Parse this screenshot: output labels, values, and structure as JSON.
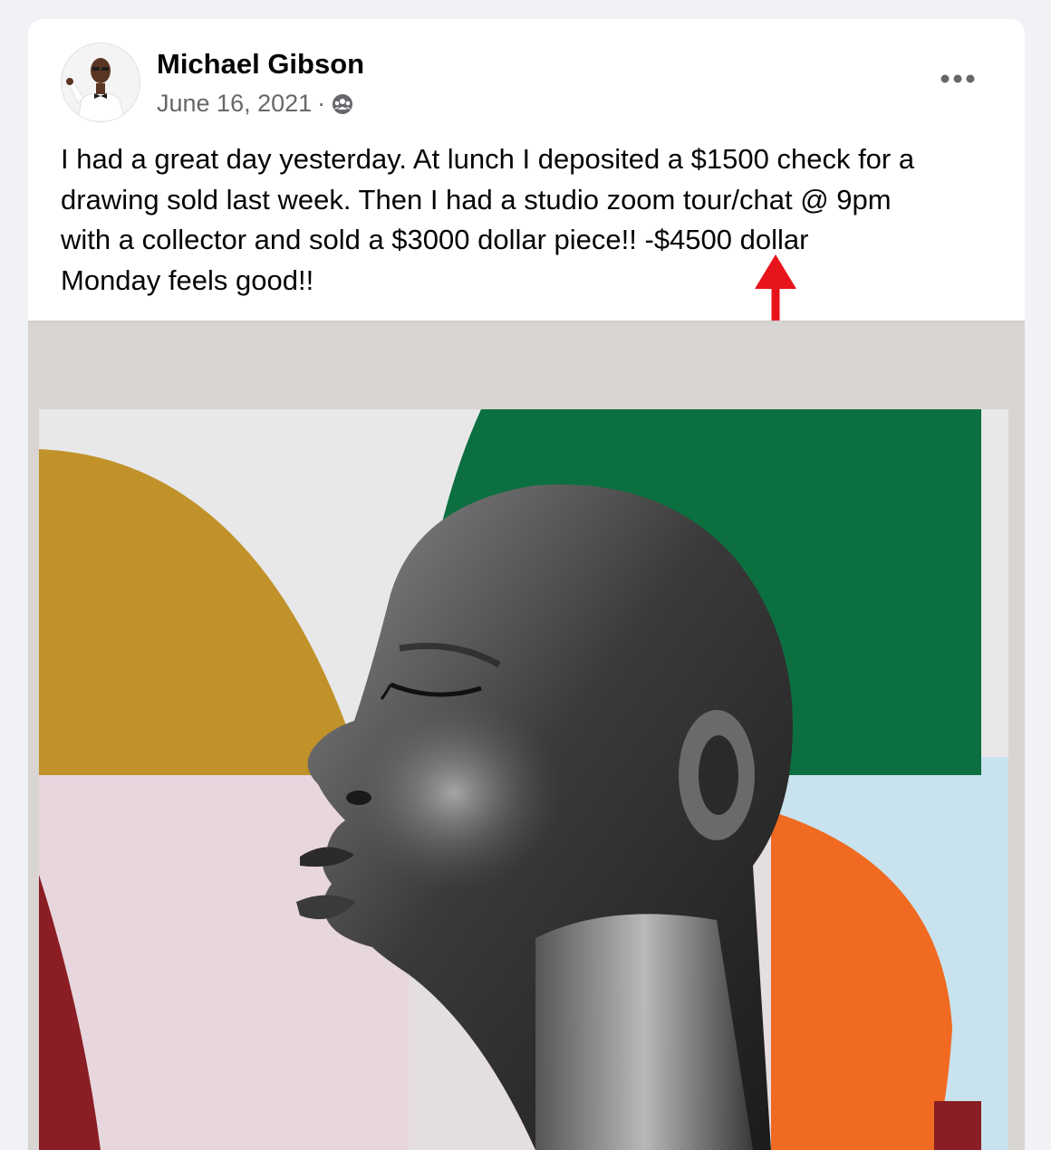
{
  "post": {
    "author_name": "Michael Gibson",
    "date": "June 16, 2021",
    "separator": "·",
    "audience_icon": "friends-icon",
    "more_icon": "more-options-icon",
    "body_lines": [
      "I had a great day yesterday. At lunch I deposited a $1500 check for a",
      "drawing sold last week. Then I had a studio zoom tour/chat @ 9pm",
      "with a collector and sold a $3000 dollar piece!! -$4500 dollar",
      "Monday feels good!!"
    ],
    "annotation_color": "#e8141b"
  },
  "image": {
    "subject": "painting-portrait",
    "colors": {
      "wall": "#d9d5d2",
      "canvas_bg": "#e8e8ea",
      "mustard": "#c1922a",
      "green": "#0c6f3f",
      "pink": "#e8d6de",
      "orange": "#f06a21",
      "light_blue": "#c8e2ee",
      "maroon": "#8a1e24"
    }
  }
}
